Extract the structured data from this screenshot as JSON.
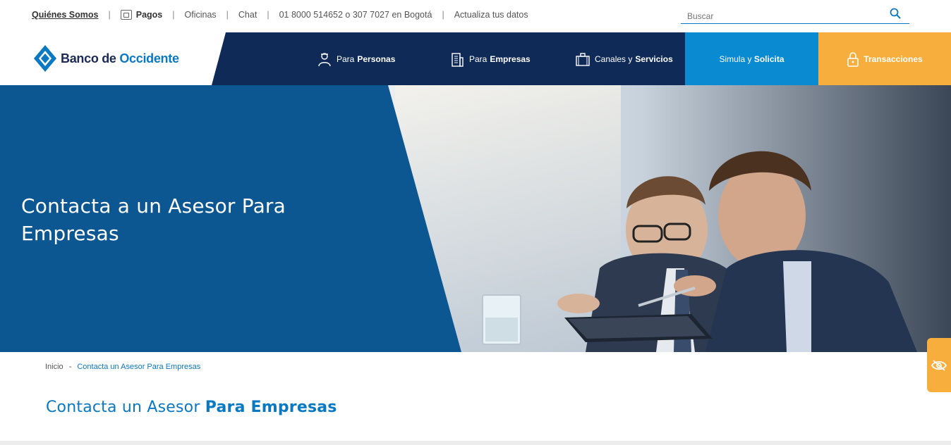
{
  "topbar": {
    "quienes": "Quiénes Somos",
    "pagos": "Pagos",
    "oficinas": "Oficinas",
    "chat": "Chat",
    "telefono": "01 8000 514652 o 307 7027 en Bogotá",
    "actualiza": "Actualiza tus datos",
    "separator": "|",
    "search_placeholder": "Buscar"
  },
  "logo": {
    "part1": "Banco de ",
    "part2": "Occidente"
  },
  "nav": {
    "personas": {
      "pre": "Para",
      "bold": "Personas"
    },
    "empresas": {
      "pre": "Para",
      "bold": "Empresas"
    },
    "canales": {
      "pre": "Canales y",
      "bold": "Servicios"
    },
    "simula": {
      "pre": "Simula y",
      "bold": "Solicita"
    },
    "transacciones": "Transacciones"
  },
  "hero": {
    "title": "Contacta a un Asesor Para Empresas"
  },
  "breadcrumb": {
    "home": "Inicio",
    "dash": "-",
    "current": "Contacta un Asesor Para Empresas"
  },
  "heading": {
    "light": "Contacta un Asesor ",
    "bold": "Para Empresas"
  },
  "colors": {
    "navy": "#0f2a57",
    "hero_blue": "#0c5692",
    "accent_blue": "#0a8ad0",
    "orange": "#f7ae3c"
  },
  "icons": {
    "pagos": "pagos-icon",
    "search": "search-icon",
    "personas": "person-icon",
    "empresas": "building-icon",
    "canales": "briefcase-icon",
    "transacciones": "lock-icon",
    "a11y": "eye-slash-icon",
    "logo": "logo-icon"
  }
}
